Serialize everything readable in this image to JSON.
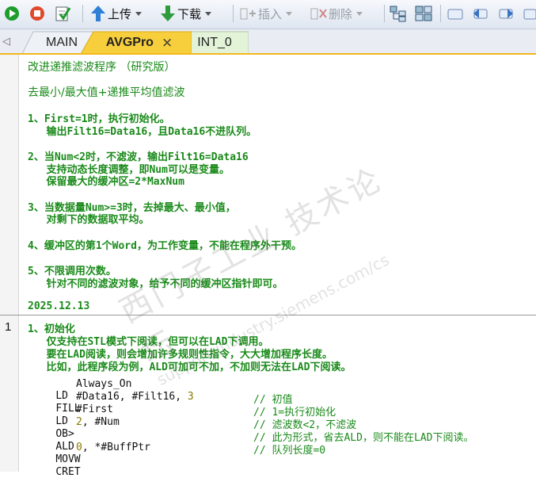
{
  "toolbar": {
    "upload_label": "上传",
    "download_label": "下载",
    "insert_label": "插入",
    "delete_label": "删除"
  },
  "tabs": [
    {
      "label": "MAIN"
    },
    {
      "label": "AVGPro",
      "close": "×"
    },
    {
      "label": "INT_0"
    }
  ],
  "tab_scroll_left": "◁",
  "header_comment": {
    "title": "改进递推滤波程序 （研究版）",
    "subtitle": "去最小/最大值+递推平均值滤波",
    "item1_l1": "1、First=1时，执行初始化。",
    "item1_l2": "   输出Filt16=Data16，且Data16不进队列。",
    "item2_l1": "2、当Num<2时，不滤波，输出Filt16=Data16",
    "item2_l2": "   支持动态长度调整，即Num可以是变量。",
    "item2_l3": "   保留最大的缓冲区=2*MaxNum",
    "item3_l1": "3、当数据量Num>=3时，去掉最大、最小值，",
    "item3_l2": "   对剩下的数据取平均。",
    "item4_l1": "4、缓冲区的第1个Word，为工作变量，不能在程序外干预。",
    "item5_l1": "5、不限调用次数。",
    "item5_l2": "   针对不同的滤波对象，给予不同的缓冲区指针即可。",
    "date": "2025.12.13"
  },
  "network": {
    "number": "1",
    "comment_l1": "1、初始化",
    "comment_l2": "   仅支持在STL模式下阅读，但可以在LAD下调用。",
    "comment_l3": "   要在LAD阅读，则会增加许多规则性指令，大大增加程序长度。",
    "comment_l4": "   比如，此程序段为例，ALD可加可不加，不加则无法在LAD下阅读。",
    "lines": [
      {
        "op": "LD",
        "arg": "Always_On",
        "comment": ""
      },
      {
        "op": "FILL",
        "arg": "#Data16, #Filt16, ",
        "num": "3",
        "comment": "// 初值"
      },
      {
        "op": "LD",
        "arg": "#First",
        "comment": "// 1=执行初始化"
      },
      {
        "op": "OB>",
        "num": "2",
        "arg": ", #Num",
        "comment": "// 滤波数<2，不滤波"
      },
      {
        "op": "ALD",
        "arg": "",
        "comment": "// 此为形式，省去ALD，则不能在LAD下阅读。"
      },
      {
        "op": "MOVW",
        "num": "0",
        "arg": ", *#BuffPtr",
        "comment": "// 队列长度=0"
      },
      {
        "op": "CRET",
        "arg": "",
        "comment": ""
      }
    ]
  },
  "watermark": {
    "line1": "西门子工业   技术论坛",
    "line2": "support.industry.siemens.com/cs"
  },
  "colors": {
    "comment_green": "#1a8a1a",
    "active_tab": "#f7cf3c",
    "constant": "#8a7a00"
  }
}
